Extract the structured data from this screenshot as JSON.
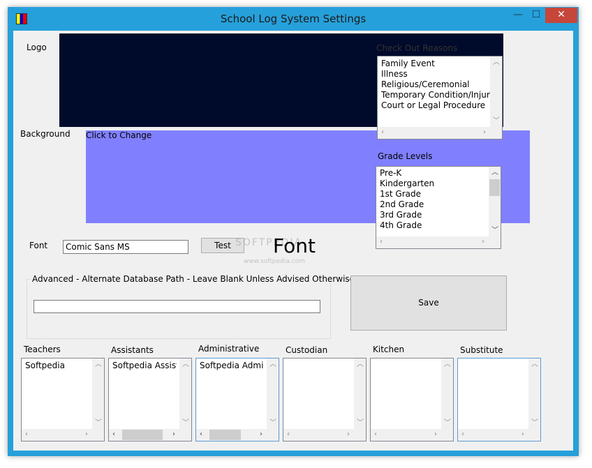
{
  "window": {
    "title": "School Log System Settings",
    "controls": {
      "minimize": "—",
      "maximize": "☐",
      "close": "✕"
    }
  },
  "logo": {
    "label": "Logo"
  },
  "background": {
    "label": "Background",
    "hint": "Click to Change"
  },
  "check_out_reasons": {
    "label": "Check Out Reasons",
    "items": [
      "Family Event",
      "Illness",
      "Religious/Ceremonial",
      "Temporary Condition/Injury",
      "Court or Legal Procedure"
    ]
  },
  "grade_levels": {
    "label": "Grade Levels",
    "items": [
      "Pre-K",
      "Kindergarten",
      "1st Grade",
      "2nd Grade",
      "3rd Grade",
      "4th Grade"
    ]
  },
  "font": {
    "label": "Font",
    "value": "Comic Sans MS",
    "test_button": "Test",
    "preview": "Font"
  },
  "advanced": {
    "label": "Advanced - Alternate Database Path - Leave Blank Unless Advised Otherwise",
    "path_value": ""
  },
  "save_button": "Save",
  "watermark": {
    "text": "SOFTPEDIA",
    "url": "www.softpedia.com"
  },
  "staff_lists": [
    {
      "label": "Teachers",
      "items": [
        "Softpedia"
      ]
    },
    {
      "label": "Assistants",
      "items": [
        "Softpedia Assistant"
      ]
    },
    {
      "label": "Administrative",
      "items": [
        "Softpedia Administrative"
      ]
    },
    {
      "label": "Custodian",
      "items": []
    },
    {
      "label": "Kitchen",
      "items": []
    },
    {
      "label": "Substitute",
      "items": []
    }
  ],
  "colors": {
    "logo_bg": "#000a2a",
    "background_color": "#8080ff",
    "frame": "#26a0da",
    "close_button": "#c7463a"
  }
}
